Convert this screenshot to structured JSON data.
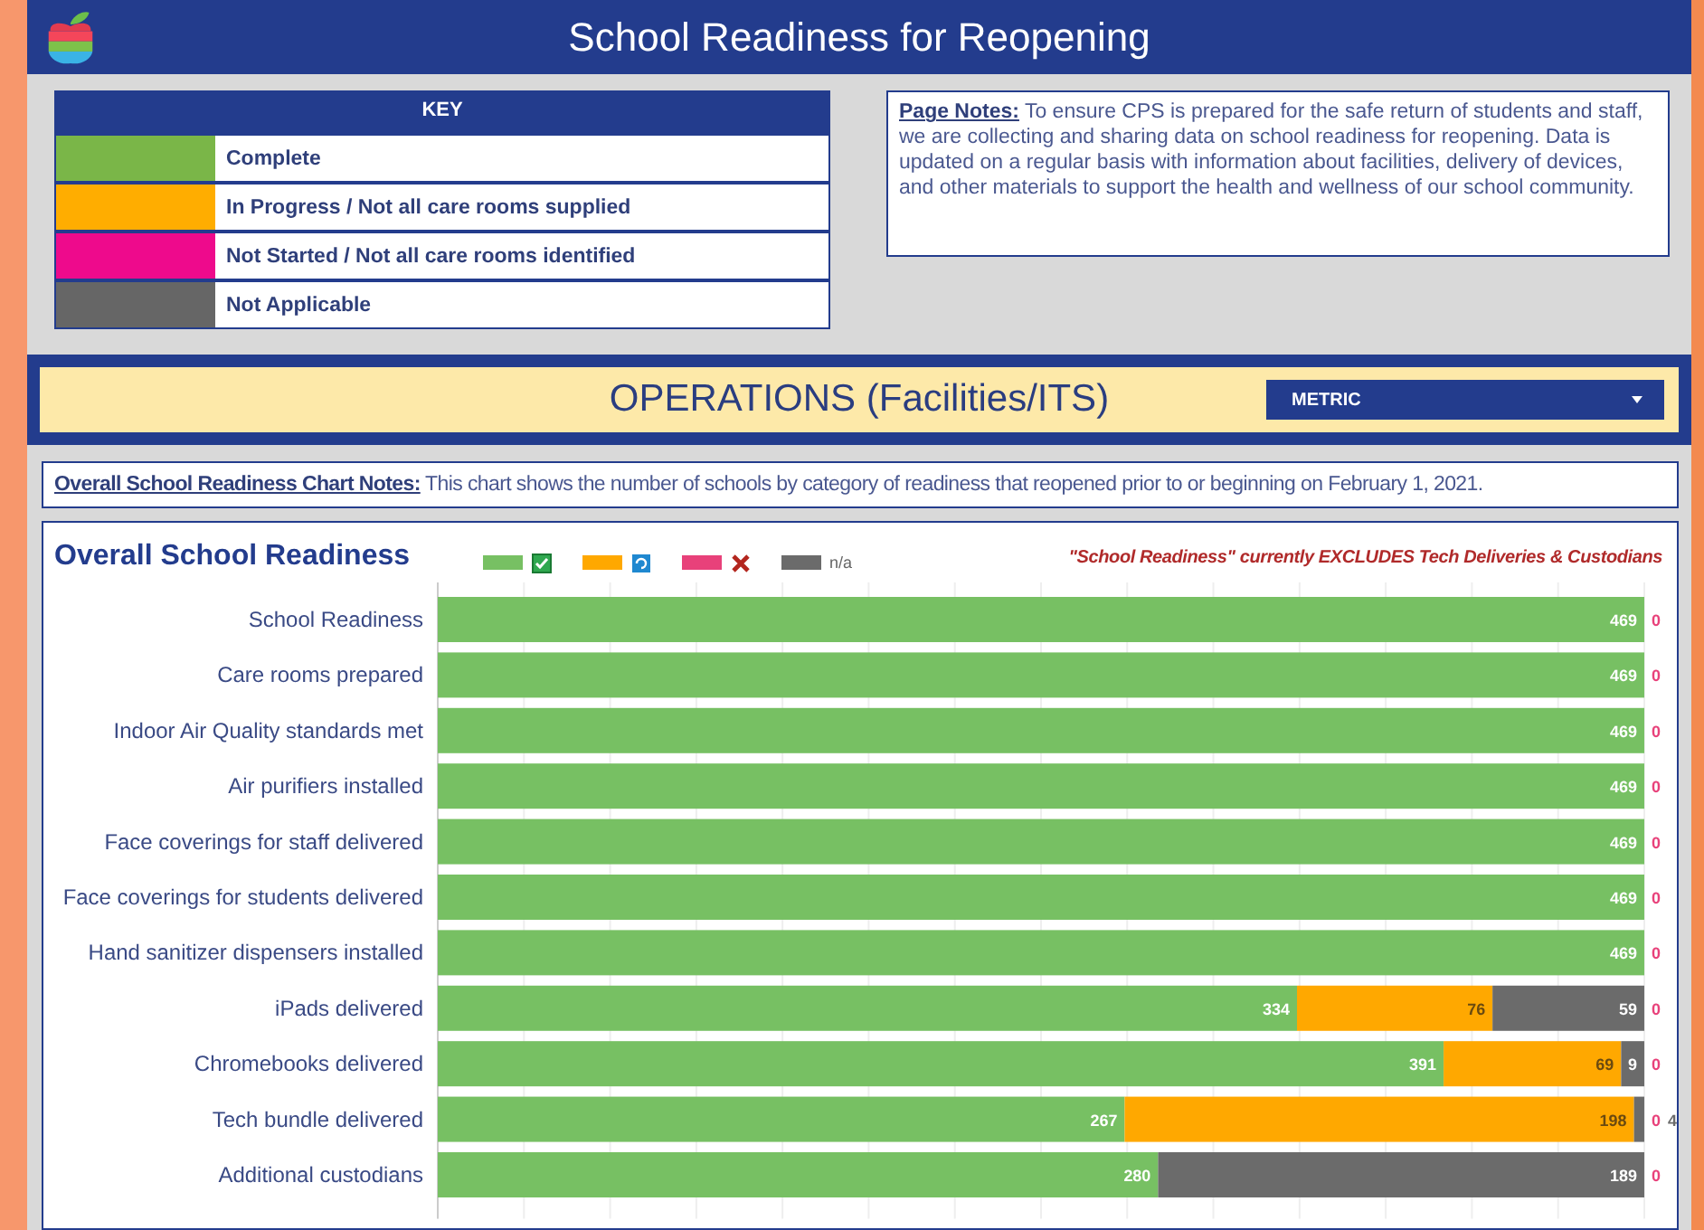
{
  "header": {
    "title": "School Readiness for Reopening"
  },
  "key": {
    "title": "KEY",
    "items": [
      {
        "label": "Complete",
        "color": "#7ab648"
      },
      {
        "label": "In Progress / Not all care rooms supplied",
        "color": "#ffad00"
      },
      {
        "label": "Not Started / Not all care rooms identified",
        "color": "#ee0a8c"
      },
      {
        "label": "Not Applicable",
        "color": "#666666"
      }
    ]
  },
  "page_notes": {
    "label": "Page Notes:",
    "text": "To ensure CPS is prepared for the safe return of students and staff, we are collecting and sharing data on school readiness for reopening. Data is updated on a regular basis with information about facilities, delivery of devices, and other materials to support the health and wellness of our school community."
  },
  "section": {
    "title": "OPERATIONS (Facilities/ITS)",
    "dropdown": {
      "value": "METRIC"
    }
  },
  "chart_notes": {
    "label": "Overall School Readiness Chart Notes:",
    "text": "This chart shows the number of schools by category of readiness that reopened prior to or beginning on February 1, 2021."
  },
  "chart": {
    "title": "Overall School Readiness",
    "note": "\"School Readiness\" currently EXCLUDES Tech Deliveries & Custodians",
    "chart_data": {
      "type": "bar",
      "orientation": "horizontal",
      "stacked": true,
      "data_labels": true,
      "categories": [
        "School Readiness",
        "Care rooms prepared",
        "Indoor Air Quality standards met",
        "Air purifiers installed",
        "Face coverings for staff delivered",
        "Face coverings for students delivered",
        "Hand sanitizer dispensers installed",
        "iPads delivered",
        "Chromebooks delivered",
        "Tech bundle delivered",
        "Additional custodians"
      ],
      "series": [
        {
          "marker": "check",
          "color": "#77c063",
          "values": [
            469,
            469,
            469,
            469,
            469,
            469,
            469,
            334,
            391,
            267,
            280
          ]
        },
        {
          "marker": "refresh",
          "color": "#ffa800",
          "values": [
            null,
            null,
            null,
            null,
            null,
            null,
            null,
            76,
            69,
            198,
            null
          ]
        },
        {
          "marker": "cross",
          "color": "#e8417a",
          "values": [
            0,
            0,
            0,
            0,
            0,
            0,
            0,
            0,
            0,
            0,
            0
          ]
        },
        {
          "marker": "text",
          "name": "n/a",
          "color": "#6b6b6b",
          "values": [
            null,
            null,
            null,
            null,
            null,
            null,
            null,
            59,
            9,
            4,
            189
          ]
        }
      ]
    }
  }
}
